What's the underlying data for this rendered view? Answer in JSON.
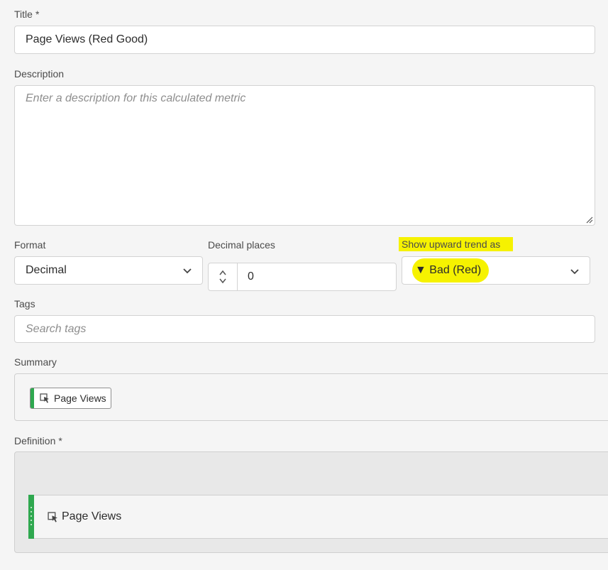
{
  "title_field": {
    "label": "Title",
    "required_mark": "*",
    "value": "Page Views (Red Good)"
  },
  "description_field": {
    "label": "Description",
    "placeholder": "Enter a description for this calculated metric"
  },
  "format_field": {
    "label": "Format",
    "value": "Decimal"
  },
  "decimal_places_field": {
    "label": "Decimal places",
    "value": "0"
  },
  "trend_field": {
    "label": "Show upward trend as",
    "value": "▼ Bad (Red)",
    "highlight_color": "#f6f200"
  },
  "tags_field": {
    "label": "Tags",
    "placeholder": "Search tags"
  },
  "summary": {
    "label": "Summary",
    "chip_label": "Page Views",
    "chip_accent": "#2fa84f"
  },
  "definition": {
    "label": "Definition",
    "required_mark": "*",
    "component_label": "Page Views",
    "component_accent": "#2fa84f"
  },
  "icons": {
    "metric": "metric-pointer-icon",
    "chevron": "chevron-down-icon",
    "stepper_up": "chevron-up-icon",
    "stepper_down": "chevron-down-icon",
    "grip": "drag-handle-icon",
    "resize": "resize-handle-icon"
  }
}
